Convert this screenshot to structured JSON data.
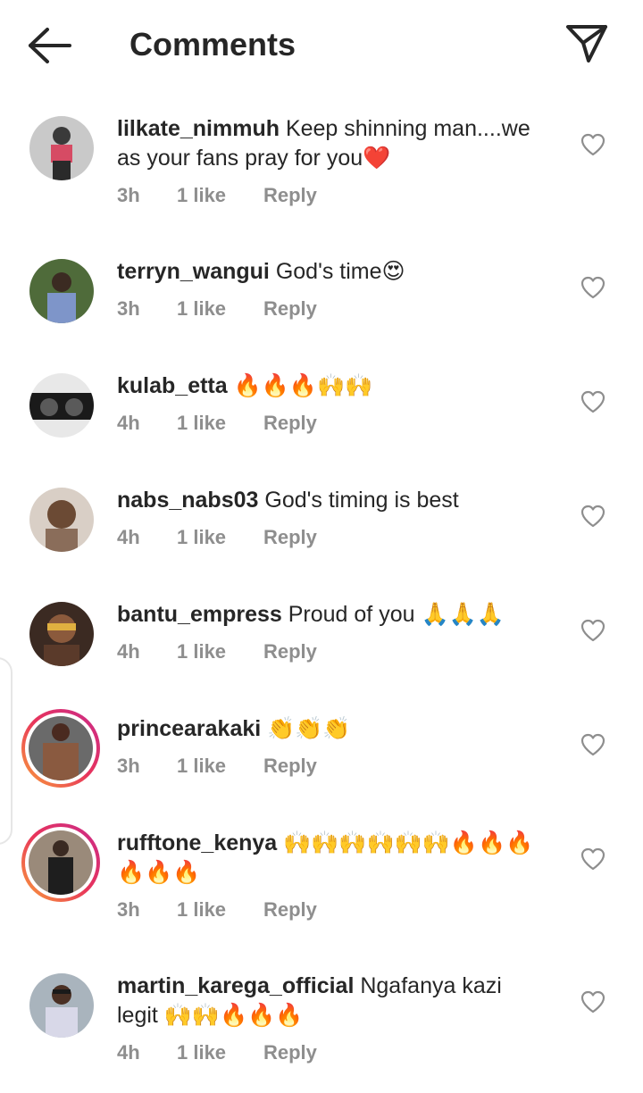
{
  "header": {
    "title": "Comments",
    "back_icon": "arrow-left-icon",
    "share_icon": "paper-plane-icon"
  },
  "comments": [
    {
      "username": "lilkate_nimmuh",
      "text": " Keep shinning man....we as your fans pray for you❤️",
      "time": "3h",
      "likes": "1 like",
      "reply": "Reply"
    },
    {
      "username": "terryn_wangui",
      "text": " God's time😍",
      "time": "3h",
      "likes": "1 like",
      "reply": "Reply"
    },
    {
      "username": "kulab_etta",
      "text": " 🔥🔥🔥🙌🙌",
      "time": "4h",
      "likes": "1 like",
      "reply": "Reply"
    },
    {
      "username": "nabs_nabs03",
      "text": " God's timing is best",
      "time": "4h",
      "likes": "1 like",
      "reply": "Reply"
    },
    {
      "username": "bantu_empress",
      "text": " Proud of you 🙏🙏🙏",
      "time": "4h",
      "likes": "1 like",
      "reply": "Reply"
    },
    {
      "username": "princearakaki",
      "text": " 👏👏👏",
      "time": "3h",
      "likes": "1 like",
      "reply": "Reply"
    },
    {
      "username": "rufftone_kenya",
      "text": " 🙌🙌🙌🙌🙌🙌🔥🔥🔥🔥🔥🔥",
      "time": "3h",
      "likes": "1 like",
      "reply": "Reply"
    },
    {
      "username": "martin_karega_official",
      "text": " Ngafanya kazi legit 🙌🙌🔥🔥🔥",
      "time": "4h",
      "likes": "1 like",
      "reply": "Reply"
    }
  ],
  "colors": {
    "text": "#262626",
    "muted": "#8e8e8e",
    "story_ring": "#e8345b"
  }
}
